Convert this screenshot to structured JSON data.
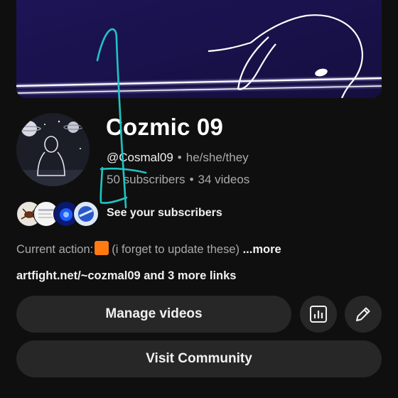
{
  "channel": {
    "name": "Cozmic 09",
    "handle": "@Cosmal09",
    "pronouns": "he/she/they",
    "subscribers": "50 subscribers",
    "videos": "34 videos",
    "meta_separator": "•"
  },
  "subscribers_preview": {
    "label": "See your subscribers"
  },
  "description": {
    "prefix": "Current action:",
    "text": "(i forget to update these)",
    "more": "...more"
  },
  "links": {
    "text": "artfight.net/~cozmal09 and 3 more links"
  },
  "actions": {
    "manage_videos": "Manage videos",
    "visit_community": "Visit Community"
  },
  "icons": {
    "analytics": "analytics-icon",
    "edit": "pencil-icon"
  },
  "colors": {
    "background": "#0f0f0f",
    "button": "#272727",
    "doodle": "#1fc4c4",
    "status_square": "#ff7a12"
  }
}
